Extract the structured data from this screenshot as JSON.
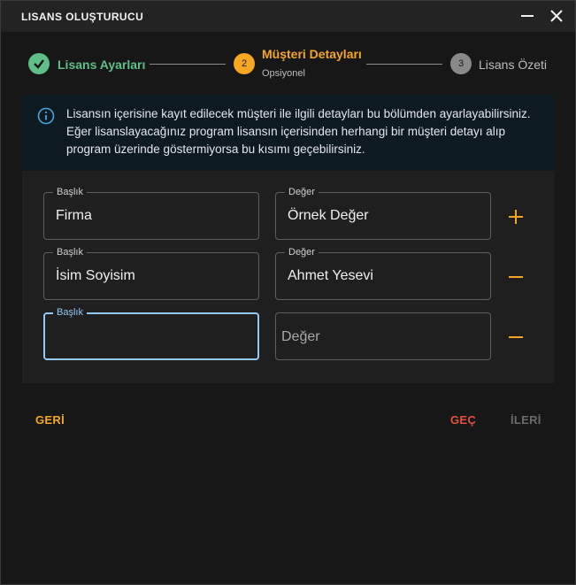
{
  "window": {
    "title": "LISANS OLUŞTURUCU"
  },
  "stepper": {
    "steps": [
      {
        "label": "Lisans Ayarları",
        "status": "completed"
      },
      {
        "number": "2",
        "label": "Müşteri Detayları",
        "sublabel": "Opsiyonel",
        "status": "active"
      },
      {
        "number": "3",
        "label": "Lisans Özeti",
        "status": "inactive"
      }
    ]
  },
  "info": {
    "text": "Lisansın içerisine kayıt edilecek müşteri ile ilgili detayları bu bölümden ayarlayabilirsiniz. Eğer lisanslayacağınız program lisansın içerisinden herhangi bir müşteri detayı alıp program üzerinde göstermiyorsa bu kısımı geçebilirsiniz."
  },
  "rows": [
    {
      "title_label": "Başlık",
      "title_value": "Firma",
      "value_label": "Değer",
      "value_value": "Örnek Değer",
      "action": "add"
    },
    {
      "title_label": "Başlık",
      "title_value": "İsim Soyisim",
      "value_label": "Değer",
      "value_value": "Ahmet Yesevi",
      "action": "remove"
    },
    {
      "title_label": "Başlık",
      "title_value": "",
      "value_placeholder": "Değer",
      "action": "remove"
    }
  ],
  "footer": {
    "back_label": "GERİ",
    "skip_label": "GEÇ",
    "next_label": "İLERİ"
  },
  "colors": {
    "accent_orange": "#f5a623",
    "success_green": "#5fbf87",
    "skip_red": "#e5533d",
    "focus_blue": "#90caf9",
    "disabled_gray": "#6b6b6b"
  }
}
